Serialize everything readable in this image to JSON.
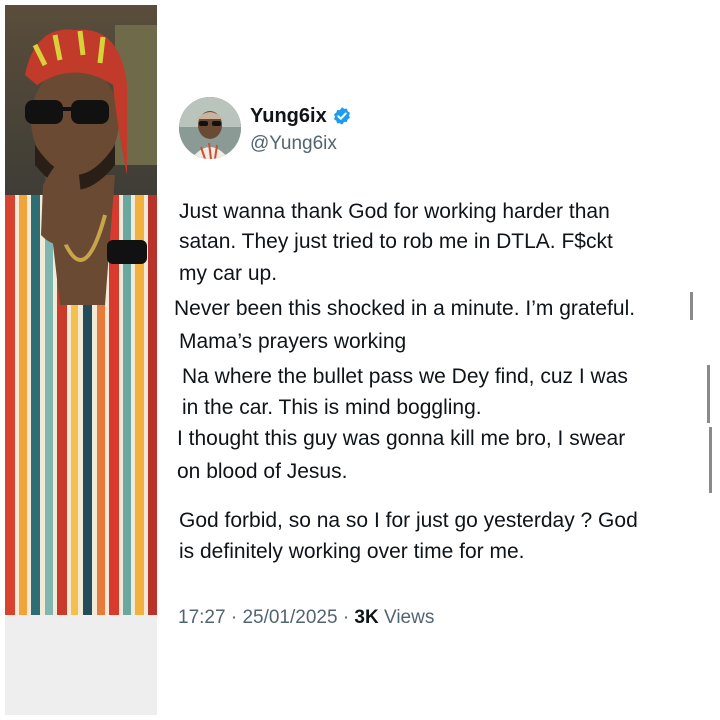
{
  "tweet": {
    "display_name": "Yung6ix",
    "handle": "@Yung6ix",
    "verified_icon": "verified-badge-icon",
    "verified_color": "#1d9bf0",
    "lines": [
      "Just wanna thank God for working harder than",
      "satan. They just tried to rob me in DTLA. F$ckt",
      "my car up.",
      "Never been this shocked in a minute. I’m grateful.",
      "Mama’s prayers working",
      "Na where the bullet pass we Dey find, cuz I was",
      "in the car. This is mind boggling.",
      "I thought this guy was gonna kill me bro, I swear",
      "on blood of Jesus.",
      "God forbid, so na so I for just go yesterday ? God",
      "is definitely working over time for me."
    ],
    "time": "17:27",
    "date": "25/01/2025",
    "separator": "·",
    "views_count": "3K",
    "views_label": "Views"
  }
}
